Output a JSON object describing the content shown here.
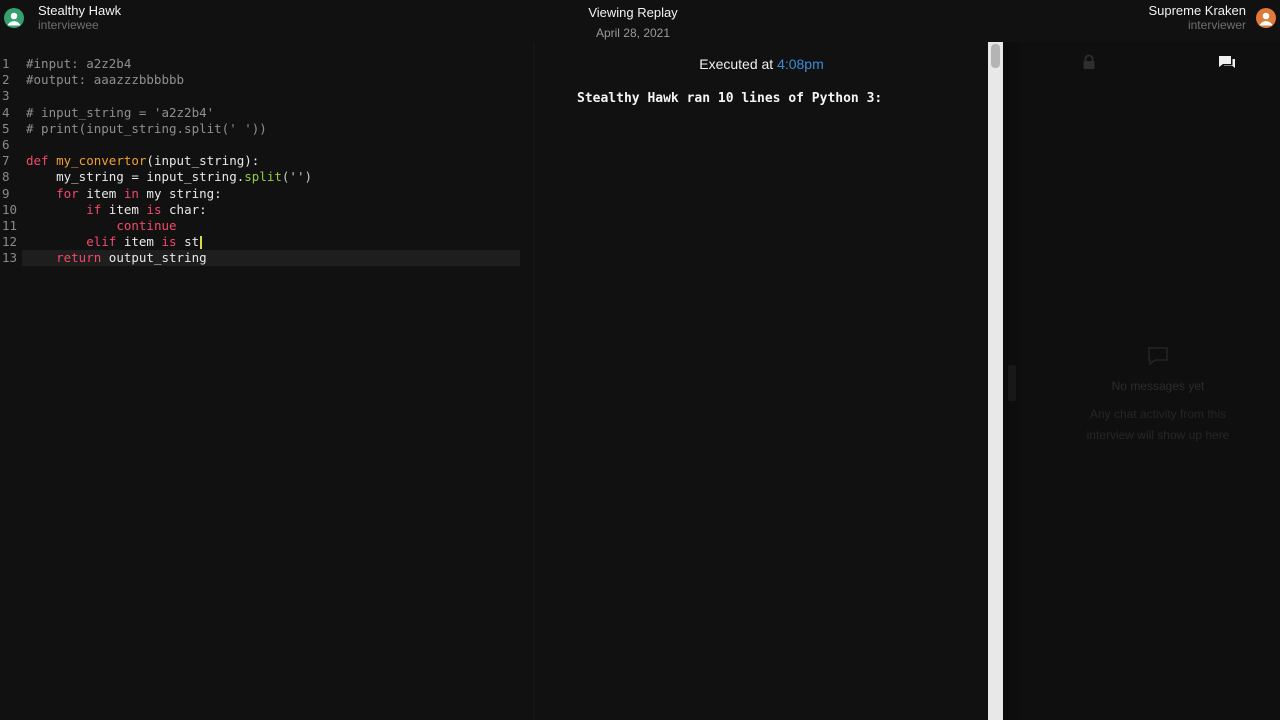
{
  "header": {
    "left_user": {
      "name": "Stealthy Hawk",
      "role": "interviewee"
    },
    "center": {
      "title": "Viewing Replay",
      "date": "April 28, 2021"
    },
    "right_user": {
      "name": "Supreme Kraken",
      "role": "interviewer"
    }
  },
  "editor": {
    "line_numbers": [
      "1",
      "2",
      "3",
      "4",
      "5",
      "6",
      "7",
      "8",
      "9",
      "10",
      "11",
      "12",
      "13"
    ],
    "lines": [
      [
        "#input: a2z2b4"
      ],
      [
        "#output: aaazzzbbbbbb"
      ],
      [],
      [
        "# input_string = 'a2z2b4'"
      ],
      [
        "# print(input_string.split(' '))"
      ],
      [],
      [
        "def",
        " ",
        "my_convertor",
        "(input_string):"
      ],
      [
        "    my_string = input_string.",
        "split",
        "('')"
      ],
      [
        "    ",
        "for",
        " item ",
        "in",
        " my string:"
      ],
      [
        "        ",
        "if",
        " item ",
        "is",
        " char:"
      ],
      [
        "            ",
        "continue"
      ],
      [
        "        ",
        "elif",
        " item ",
        "is",
        " st"
      ],
      [
        "    ",
        "return",
        " output_string"
      ]
    ],
    "active_line": 13
  },
  "output": {
    "executed_prefix": "Executed at",
    "executed_time": "4:08pm",
    "ran_text": "Stealthy Hawk ran 10 lines of Python 3:"
  },
  "chat": {
    "empty_title": "No messages yet",
    "empty_subtitle": "Any chat activity from this interview will show up here"
  },
  "colors": {
    "background": "#111111",
    "keyword": "#f04a6a",
    "function_name": "#f0a030",
    "method": "#94cc3a",
    "comment": "#8f8f8f",
    "time_link": "#3d8bd4"
  },
  "icons": [
    "user-avatar-icon",
    "lock-icon",
    "chat-icon",
    "empty-chat-icon"
  ]
}
